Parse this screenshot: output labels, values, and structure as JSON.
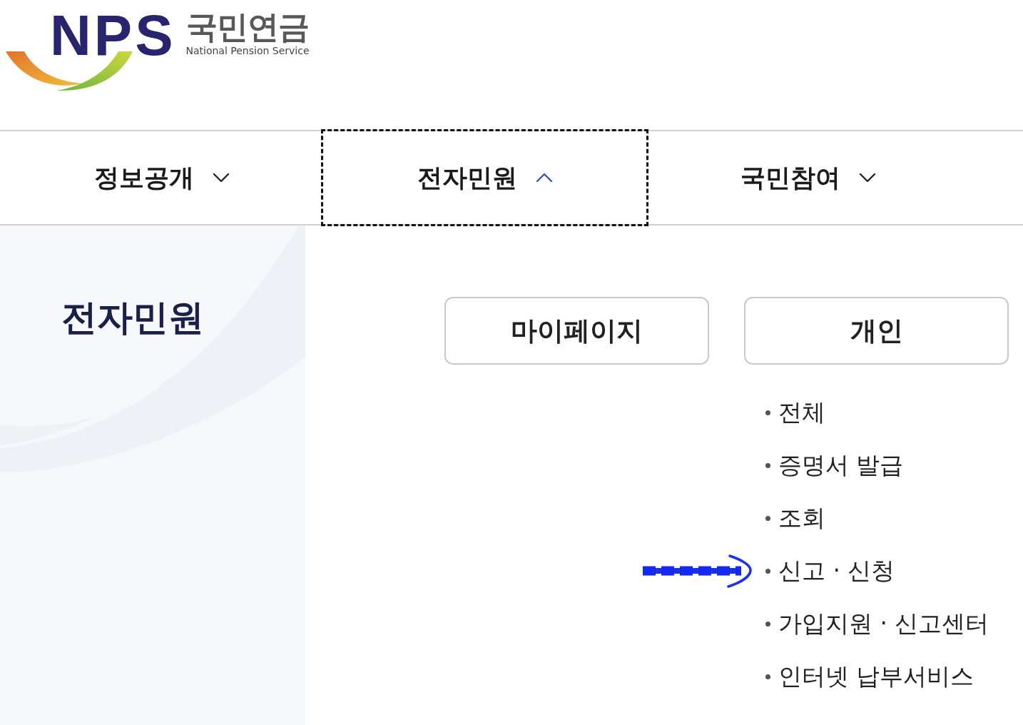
{
  "logo": {
    "mark": "NPS",
    "name": "국민연금",
    "subtitle": "National Pension Service"
  },
  "nav": [
    {
      "label": "정보공개",
      "selected": false,
      "expanded": false
    },
    {
      "label": "전자민원",
      "selected": true,
      "expanded": true
    },
    {
      "label": "국민참여",
      "selected": false,
      "expanded": false
    }
  ],
  "sidebar": {
    "title": "전자민원"
  },
  "menu_columns": [
    {
      "button": "마이페이지"
    },
    {
      "button": "개인",
      "items": [
        {
          "label": "전체",
          "pointed": false
        },
        {
          "label": "증명서 발급",
          "pointed": false
        },
        {
          "label": "조회",
          "pointed": false
        },
        {
          "label": "신고 · 신청",
          "pointed": true
        },
        {
          "label": "가입지원 · 신고센터",
          "pointed": false
        },
        {
          "label": "인터넷 납부서비스",
          "pointed": false
        }
      ]
    }
  ]
}
